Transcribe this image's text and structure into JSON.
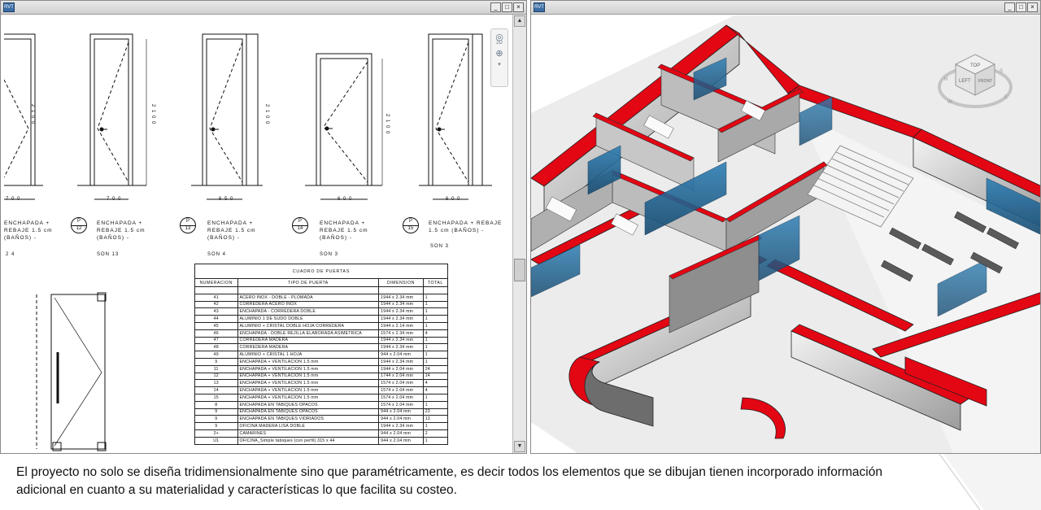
{
  "left_window": {
    "title_icon": "RVT",
    "buttons": [
      "_",
      "□",
      "×"
    ],
    "scroll_up": "▲",
    "scroll_down": "▼",
    "nav_icons": [
      "2d-steering-wheel-icon",
      "zoom-icon"
    ],
    "nav_label_2d": "2D",
    "doors": [
      {
        "label": "ENCHAPADA +\nREBAJE 1.5 cm\n(BAÑOS) -",
        "code": "2 4",
        "dim_w": "7 0 0",
        "height": "2 1 0 0"
      },
      {
        "label": "ENCHAPADA +\nREBAJE 1.5 cm\n(BAÑOS) -",
        "code": "SON 13",
        "tag_num": "12",
        "dim_w": "7 0 0",
        "height": "2 1 0 0"
      },
      {
        "label": "ENCHAPADA +\nREBAJE 1.5 cm\n(BAÑOS) -",
        "code": "SON 4",
        "tag_num": "13",
        "dim_w": "6 5 0",
        "height": "2 1 0 0"
      },
      {
        "label": "ENCHAPADA +\nREBAJE 1.5 cm\n(BAÑOS) -",
        "code": "SON 3",
        "tag_num": "14",
        "dim_w": "6 0 0",
        "height": "2 1 0 0"
      },
      {
        "label": "ENCHAPADA + REBAJE\n1.5 cm (BAÑOS) -",
        "code": "SON 3",
        "tag_num": "15",
        "dim_w": "6 0 0",
        "height": ""
      }
    ],
    "tag_letter": "P",
    "schedule": {
      "title": "CUADRO DE PUERTAS",
      "headers": [
        "NUMERACION",
        "TIPO DE PUERTA",
        "DIMENSION",
        "TOTAL"
      ],
      "rows": [
        [
          "41",
          "ACERO INOX - DOBLE - PLOMADA",
          "1944 x 2.34 mm",
          "1"
        ],
        [
          "42",
          "CORREDERA ACERO INOX",
          "1944 x 2.34 mm",
          "1"
        ],
        [
          "43",
          "ENCHAPADA - CORREDERA DOBLE",
          "1944 x 2.34 mm",
          "1"
        ],
        [
          "44",
          "ALUMINIO 1 DE SUDO DOBLE",
          "1944 x 2.34 mm",
          "1"
        ],
        [
          "45",
          "ALUMINIO + CRISTAL DOBLE HOJA CORREDERA",
          "1944 x 2.14 mm",
          "1"
        ],
        [
          "46",
          "ENCHAPADA - DOBLE REJILLA ELABORADA ASIMETRICA",
          "1574 x 2.34 mm",
          "4"
        ],
        [
          "47",
          "CORREDERA MADERA",
          "1944 x 2.34 mm",
          "1"
        ],
        [
          "48",
          "CORREDERA MADERA",
          "1944 x 2.34 mm",
          "1"
        ],
        [
          "49",
          "ALUMINIO + CRISTAL 1 HOJA",
          "944 x 2.04 mm",
          "1"
        ],
        [
          "9",
          "ENCHAPADA + VENTILACION 1.5 mm",
          "1944 x 2.34 mm",
          "1"
        ],
        [
          "11",
          "ENCHAPADA + VENTILACION 1.5 mm",
          "1944 x 2.04 mm",
          "24"
        ],
        [
          "12",
          "ENCHAPADA + VENTILACION 1.5 mm",
          "1744 x 2.04 mm",
          "14"
        ],
        [
          "13",
          "ENCHAPADA + VENTILACION 1.5 mm",
          "1574 x 2.04 mm",
          "4"
        ],
        [
          "14",
          "ENCHAPADA + VENTILACION 1.5 mm",
          "1574 x 2.04 mm",
          "4"
        ],
        [
          "15",
          "ENCHAPADA + VENTILACION 1.5 mm",
          "1574 x 2.04 mm",
          "1"
        ],
        [
          "8",
          "ENCHAPADA EN TABIQUES OPACOS",
          "1574 x 2.04 mm",
          "1"
        ],
        [
          "9",
          "ENCHAPADA EN TABIQUES OPACOS",
          "944 x 2.04 mm",
          "23"
        ],
        [
          "9",
          "ENCHAPADA EN TABIQUES VIDRIADOS",
          "944 x 2.04 mm",
          "13"
        ],
        [
          "9",
          "OFICINA MADERA LISA DOBLE",
          "1944 x 2.34 mm",
          "1"
        ],
        [
          "2+",
          "CAMARINES",
          "944 x 2.04 mm",
          "2"
        ],
        [
          "U1",
          "OFICINA_Simple tabiques (con perfil) 315 x 44",
          "944 x 2.04 mm",
          "1"
        ]
      ]
    }
  },
  "right_window": {
    "title_icon": "RVT",
    "buttons": [
      "_",
      "□",
      "×"
    ],
    "viewcube": {
      "top": "TOP",
      "left": "LEFT",
      "front": "FRONT",
      "compass": [
        "N",
        "E",
        "S",
        "W"
      ]
    }
  },
  "caption": "El proyecto no solo se diseña tridimensionalmente sino que paramétricamente, es decir todos los elementos que se dibujan tienen incorporado información adicional en cuanto a su materialidad y características lo que facilita su costeo.",
  "colors": {
    "wall_cut": "#e30613",
    "glass": "#2b6f9e",
    "floor": "#e9e9e9"
  }
}
